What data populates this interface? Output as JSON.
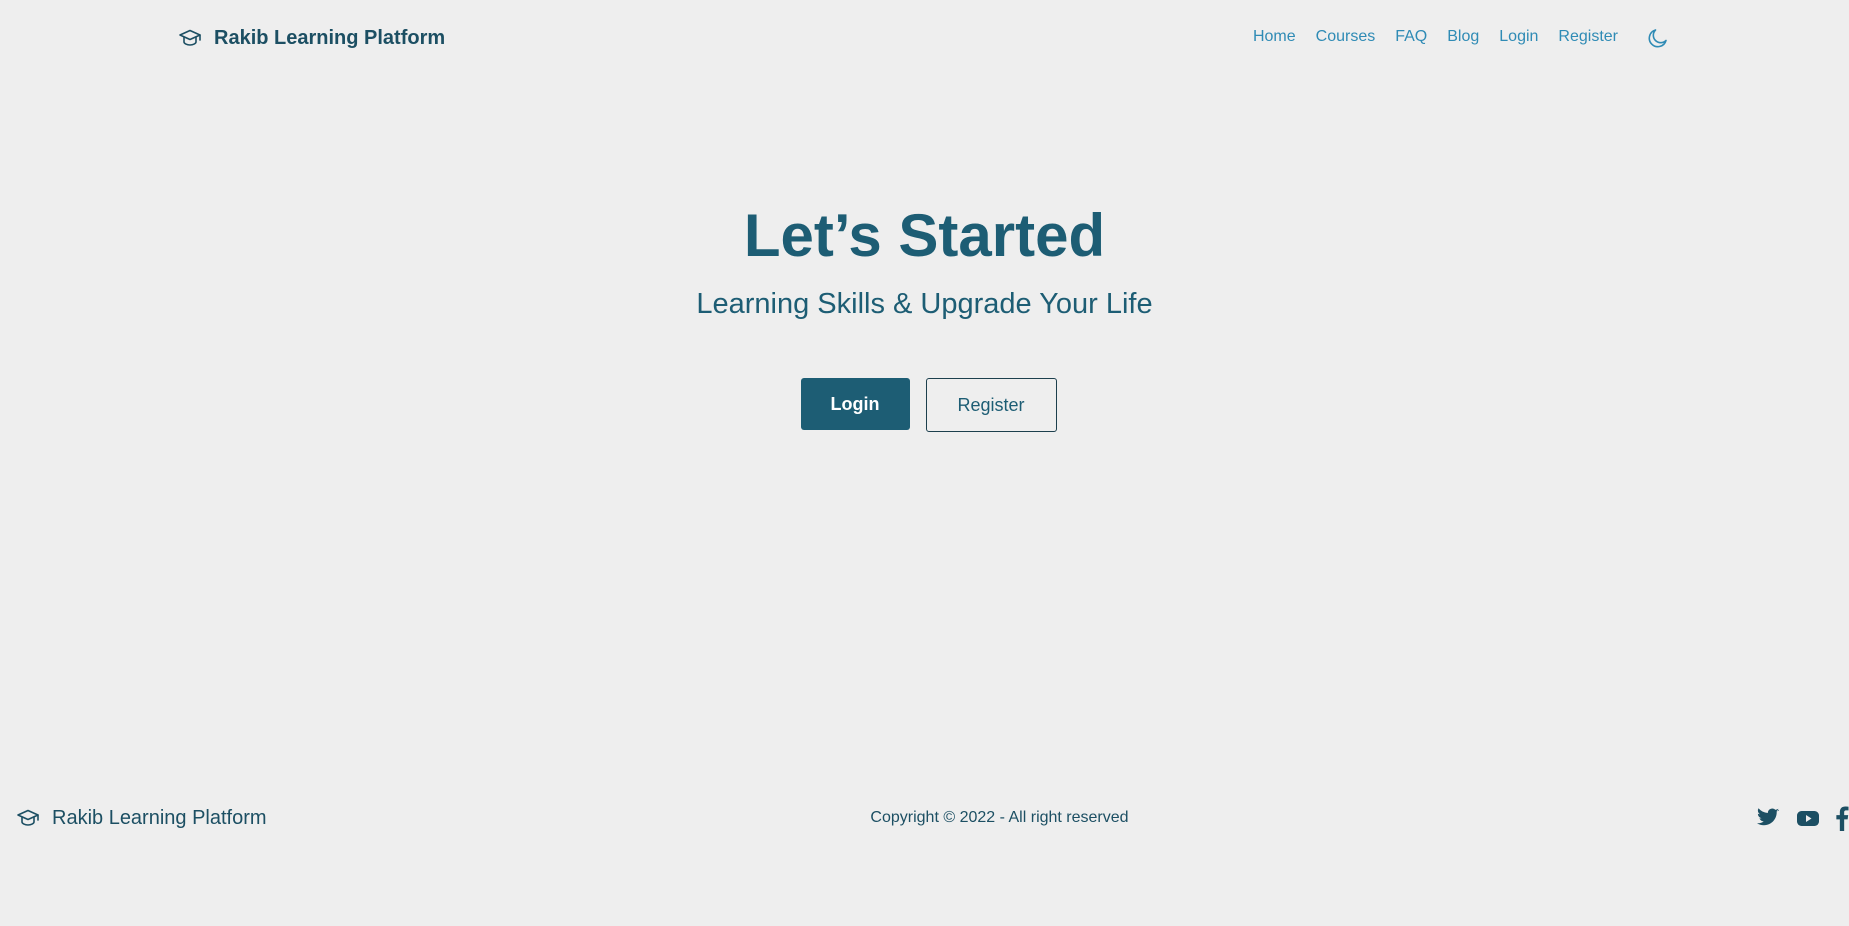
{
  "header": {
    "brand_name": "Rakib Learning Platform",
    "brand_icon": "graduation-cap-icon",
    "nav": [
      {
        "label": "Home"
      },
      {
        "label": "Courses"
      },
      {
        "label": "FAQ"
      },
      {
        "label": "Blog"
      },
      {
        "label": "Login"
      },
      {
        "label": "Register"
      }
    ],
    "theme_toggle_icon": "moon-icon"
  },
  "hero": {
    "title": "Let’s Started",
    "subtitle": "Learning Skills & Upgrade Your Life",
    "login_label": "Login",
    "register_label": "Register"
  },
  "footer": {
    "brand_name": "Rakib Learning Platform",
    "copyright": "Copyright © 2022 - All right reserved",
    "social": [
      {
        "icon": "twitter-icon"
      },
      {
        "icon": "youtube-icon"
      },
      {
        "icon": "facebook-icon"
      }
    ]
  },
  "colors": {
    "background": "#eeeeee",
    "primary": "#1d5d74",
    "nav_link": "#2f8bb5",
    "brand_text": "#1c4f63"
  }
}
